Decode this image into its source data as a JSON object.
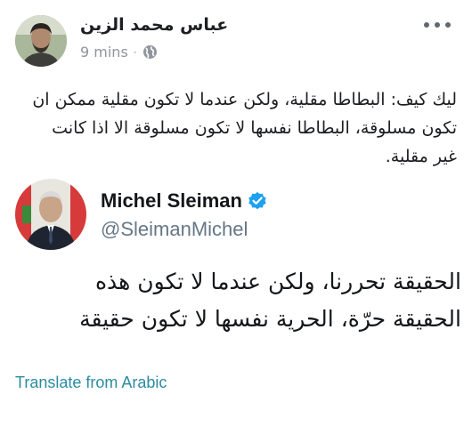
{
  "post": {
    "author": "عباس محمد الزين",
    "time": "9 mins",
    "separator": "·",
    "privacy_icon": "globe-icon",
    "more_icon": "more-dots-icon",
    "lines": [
      "ليك كيف: البطاطا مقلية، ولكن عندما لا تكون مقلية ممكن ان",
      "تكون مسلوقة، البطاطا نفسها لا تكون مسلوقة الا اذا كانت",
      "غير مقلية."
    ]
  },
  "tweet": {
    "name": "Michel Sleiman",
    "verified_icon": "verified-badge-icon",
    "handle": "@SleimanMichel",
    "lines": [
      "الحقيقة تحررنا، ولكن عندما لا تكون هذه",
      "الحقيقة حرّة، الحرية نفسها لا تكون حقيقة"
    ],
    "translate_label": "Translate from Arabic"
  },
  "colors": {
    "text": "#1c1e21",
    "meta": "#90949c",
    "handle": "#657786",
    "verified": "#1da1f2",
    "link": "#2b8ca0"
  }
}
